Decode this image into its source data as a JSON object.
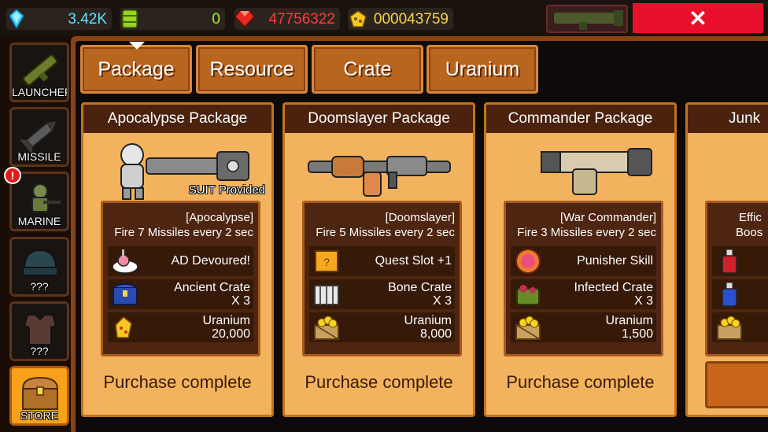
{
  "topbar": {
    "gems": "3.42K",
    "fuel": "0",
    "rubies": "47756322",
    "gold": "000043759",
    "close_label": "✕"
  },
  "sidebar": {
    "items": [
      {
        "label": "LAUNCHER"
      },
      {
        "label": "MISSILE"
      },
      {
        "label": "MARINE"
      },
      {
        "label": "???"
      },
      {
        "label": "???"
      },
      {
        "label": "STORE"
      }
    ],
    "alert": "!"
  },
  "tabs": [
    {
      "label": "Package"
    },
    {
      "label": "Resource"
    },
    {
      "label": "Crate"
    },
    {
      "label": "Uranium"
    }
  ],
  "cards": [
    {
      "title": "Apocalypse Package",
      "badge": "SUIT Provided",
      "desc1": "[Apocalypse]",
      "desc2": "Fire 7 Missiles every 2 sec",
      "rows": [
        {
          "l1": "AD Devoured!",
          "l2": ""
        },
        {
          "l1": "Ancient Crate",
          "l2": "X 3"
        },
        {
          "l1": "Uranium",
          "l2": "20,000"
        }
      ],
      "status": "Purchase complete"
    },
    {
      "title": "Doomslayer Package",
      "badge": "",
      "desc1": "[Doomslayer]",
      "desc2": "Fire 5 Missiles every 2 sec",
      "rows": [
        {
          "l1": "Quest Slot +1",
          "l2": ""
        },
        {
          "l1": "Bone Crate",
          "l2": "X 3"
        },
        {
          "l1": "Uranium",
          "l2": "8,000"
        }
      ],
      "status": "Purchase complete"
    },
    {
      "title": "Commander Package",
      "badge": "",
      "desc1": "[War Commander]",
      "desc2": "Fire 3 Missiles every 2 sec",
      "rows": [
        {
          "l1": "Punisher Skill",
          "l2": ""
        },
        {
          "l1": "Infected Crate",
          "l2": "X 3"
        },
        {
          "l1": "Uranium",
          "l2": "1,500"
        }
      ],
      "status": "Purchase complete"
    },
    {
      "title": "Junk",
      "badge": "",
      "desc1": "Effic",
      "desc2": "Boos",
      "rows": [
        {
          "l1": "",
          "l2": ""
        },
        {
          "l1": "",
          "l2": ""
        },
        {
          "l1": "",
          "l2": ""
        }
      ],
      "status": ""
    }
  ]
}
